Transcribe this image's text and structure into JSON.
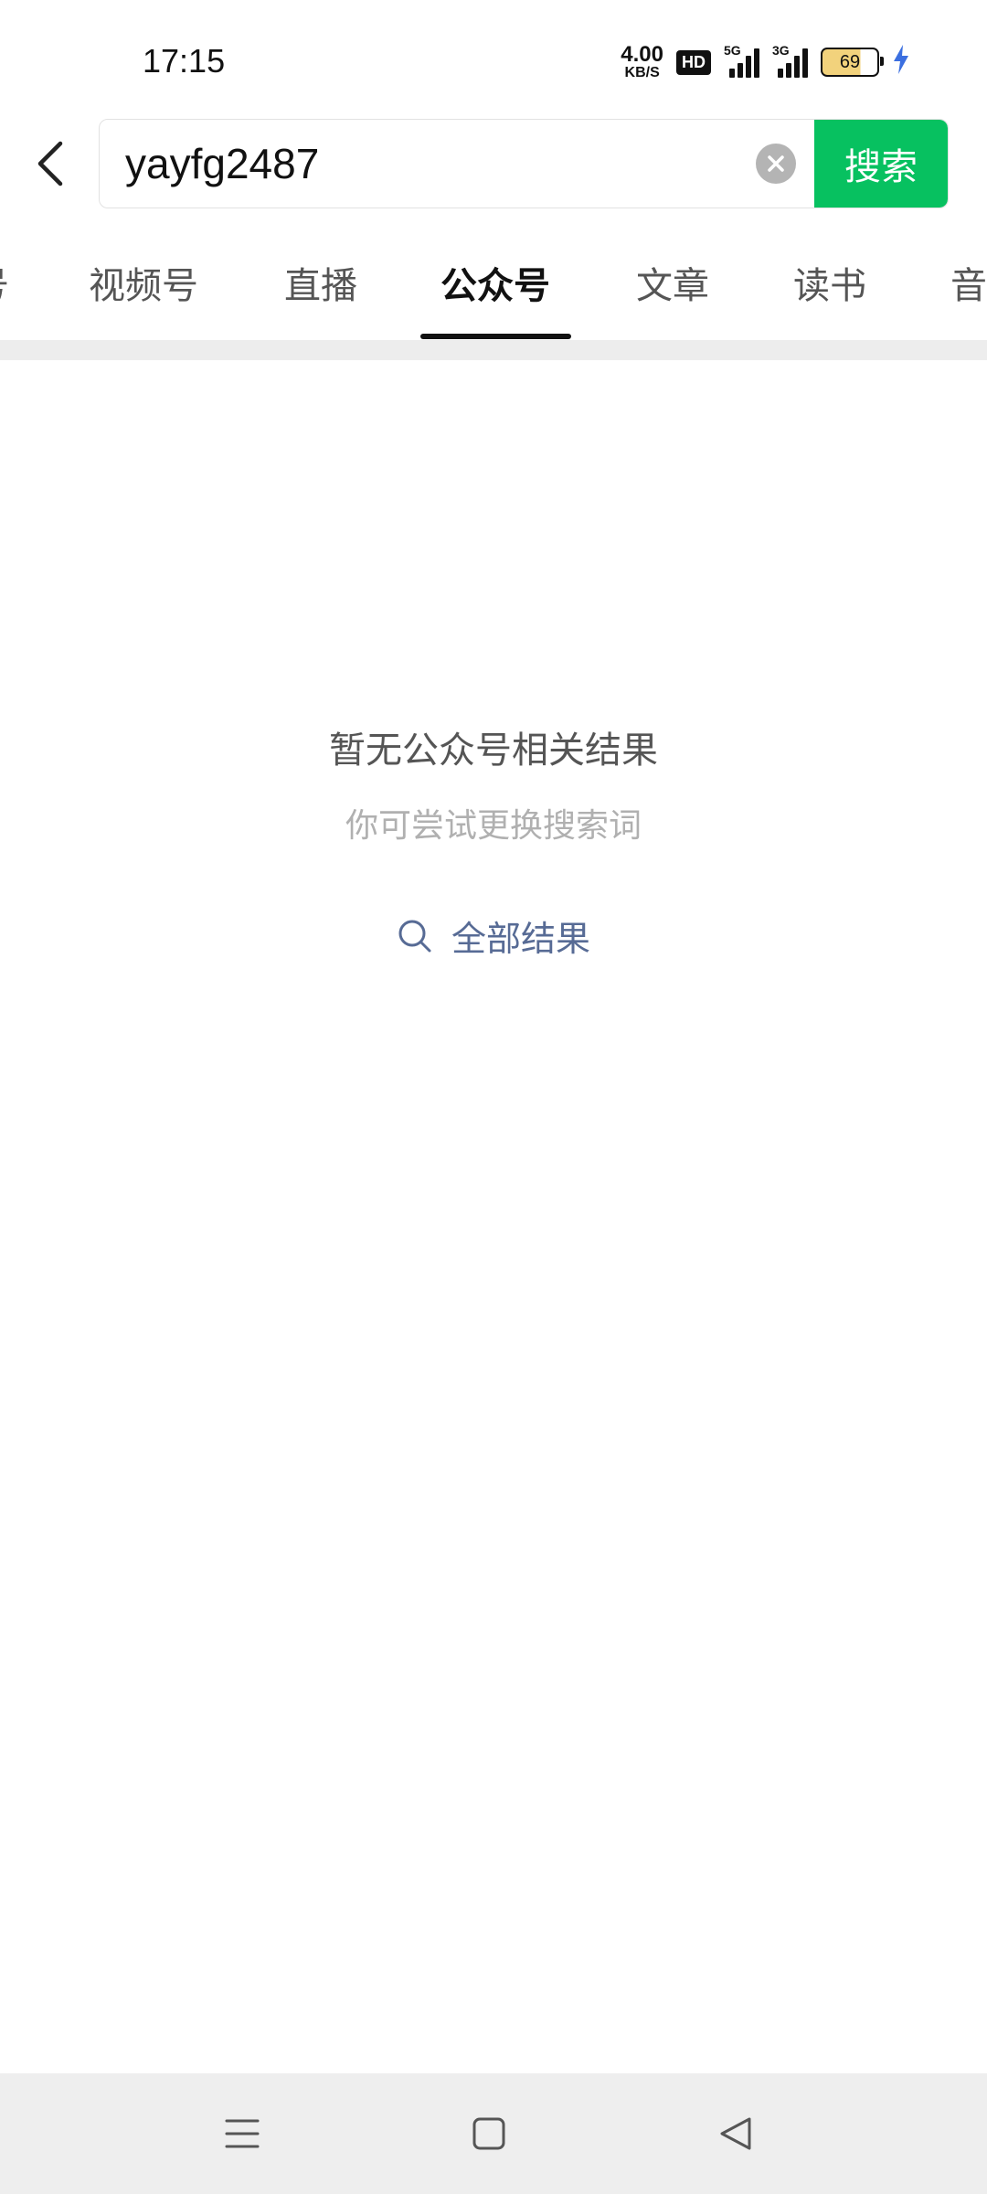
{
  "status_bar": {
    "time": "17:15",
    "net_speed_value": "4.00",
    "net_speed_unit": "KB/S",
    "hd_label": "HD",
    "signal1_label": "5G",
    "signal2_label": "3G",
    "battery_level": "69",
    "charging_color": "#3b6fe0"
  },
  "search": {
    "query": "yayfg2487",
    "button_label": "搜索",
    "button_color": "#07c160",
    "back_icon": "chevron-left-icon",
    "clear_icon": "clear-circle-icon"
  },
  "tabs": [
    {
      "label": "号",
      "active": false
    },
    {
      "label": "视频号",
      "active": false
    },
    {
      "label": "直播",
      "active": false
    },
    {
      "label": "公众号",
      "active": true
    },
    {
      "label": "文章",
      "active": false
    },
    {
      "label": "读书",
      "active": false
    },
    {
      "label": "音",
      "active": false
    }
  ],
  "empty_state": {
    "title": "暂无公众号相关结果",
    "subtitle": "你可尝试更换搜索词",
    "action_label": "全部结果",
    "action_icon": "search-icon",
    "action_color": "#576b95"
  },
  "nav_bar": {
    "menu_icon": "menu-icon",
    "home_icon": "home-square-icon",
    "back_icon": "back-triangle-icon"
  }
}
